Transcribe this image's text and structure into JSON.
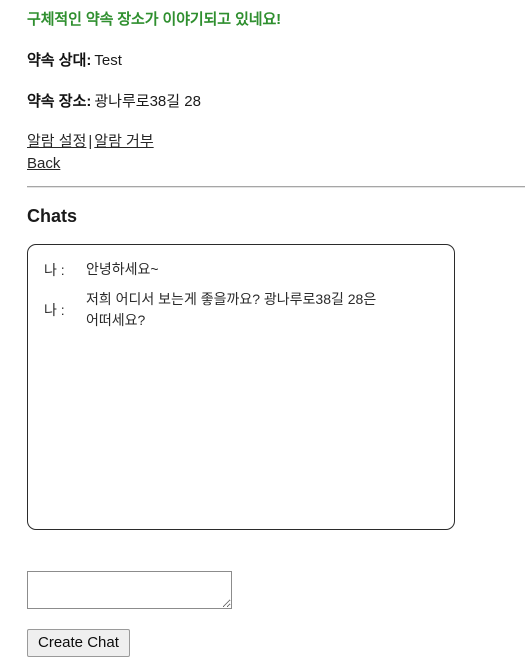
{
  "alert": {
    "headline": "구체적인 약속 장소가 이야기되고 있네요!",
    "color": "#2f8f2f"
  },
  "appointment": {
    "partner_label": "약속 상대:",
    "partner_value": "Test",
    "place_label": "약속 장소:",
    "place_value": "광나루로38길 28"
  },
  "links": {
    "alarm_set": "알람 설정",
    "separator": "|",
    "alarm_reject": "알람 거부",
    "back": "Back"
  },
  "chats_section": {
    "heading": "Chats",
    "messages": [
      {
        "speaker": "나 :",
        "text": "안녕하세요~"
      },
      {
        "speaker": "나 :",
        "text": "저희 어디서 보는게 좋을까요? 광나루로38길 28은 어떠세요?"
      }
    ]
  },
  "composer": {
    "input_value": "",
    "input_placeholder": "",
    "submit_label": "Create Chat"
  }
}
